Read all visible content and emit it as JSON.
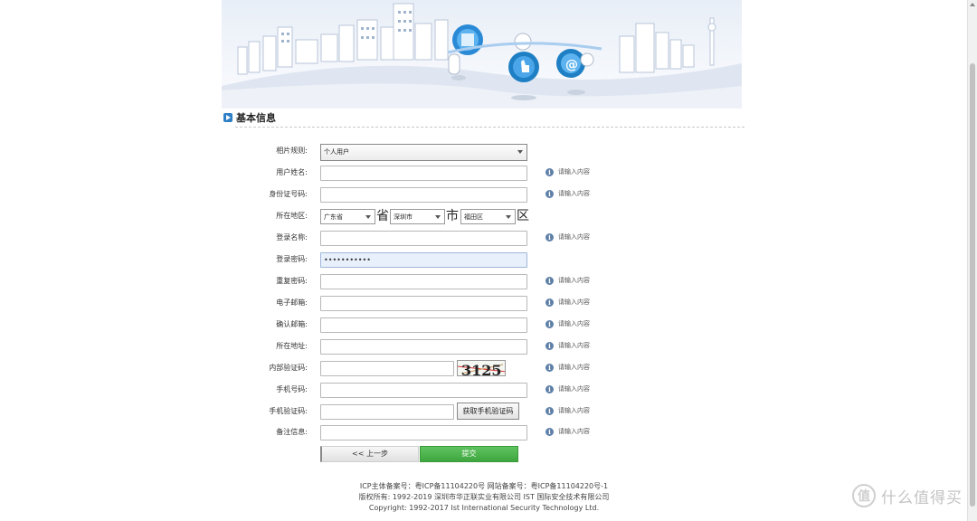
{
  "section": {
    "title": "基本信息"
  },
  "hint_text": "请输入内容",
  "form": {
    "rule_label": "相片规则:",
    "rule_value": "个人用户",
    "name_label": "用户姓名:",
    "id_label": "身份证号码:",
    "region_label": "所在地区:",
    "province": "广东省",
    "province_suffix": "省",
    "city": "深圳市",
    "city_suffix": "市",
    "district": "福田区",
    "district_suffix": "区",
    "login_label": "登录名称:",
    "password_label": "登录密码:",
    "password_value": "•••••••••••",
    "repeat_label": "重复密码:",
    "email_label": "电子邮箱:",
    "confirm_email_label": "确认邮箱:",
    "address_label": "所在地址:",
    "captcha_label": "内部验证码:",
    "captcha_text": "3125",
    "phone_label": "手机号码:",
    "sms_label": "手机验证码:",
    "sms_button": "获取手机验证码",
    "remark_label": "备注信息:"
  },
  "buttons": {
    "prev": "<< 上一步",
    "submit": "提交"
  },
  "footer": {
    "line1": "ICP主体备案号：粤ICP备11104220号 网站备案号：粤ICP备11104220号-1",
    "line2": "版权所有: 1992-2019 深圳市华正联实业有限公司 IST 国际安全技术有限公司",
    "line3": "Copyright: 1992-2017 Ist International Security Technology Ltd."
  },
  "watermark": {
    "text": "什么值得买",
    "logo": "值"
  },
  "colors": {
    "accent": "#2d7fc6",
    "submit": "#4cb44c",
    "banner_blue": "#1f7fc4"
  }
}
